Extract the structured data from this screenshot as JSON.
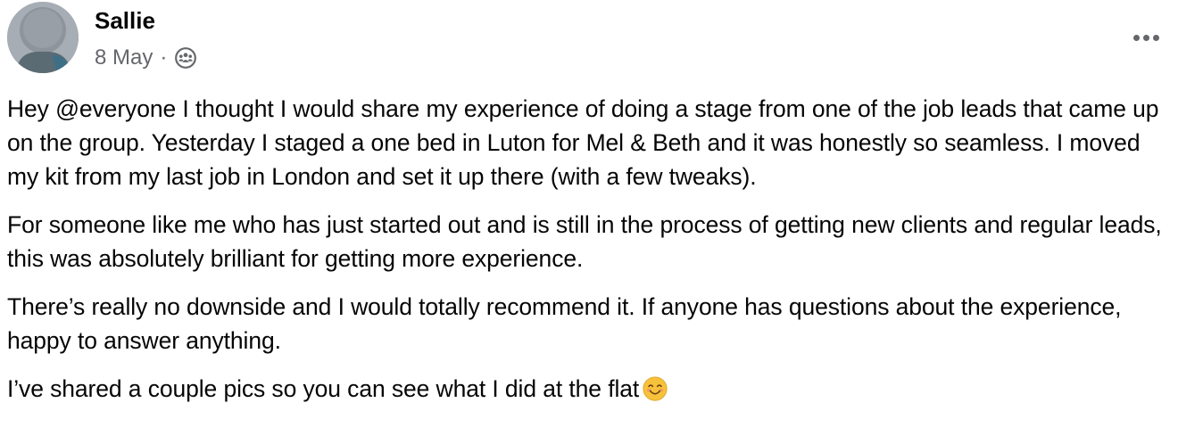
{
  "post": {
    "author": "Sallie",
    "date": "8 May",
    "separator": "·",
    "audience_icon": "group-audience-icon",
    "more_icon": "more-options-icon",
    "paragraphs": [
      "Hey @everyone I thought I would share my experience of doing a stage from one of the job leads that came up on the group. Yesterday I staged a one bed in Luton for Mel & Beth and it was honestly so seamless. I moved my kit from my last job in London and set it up there (with a few tweaks).",
      "For someone like me who has just started out and is still in the process of getting new clients and regular leads, this was absolutely brilliant for getting more experience.",
      "There’s really no downside and I would totally recommend it. If anyone has questions about the experience, happy to answer anything.",
      "I’ve shared a couple pics so you can see what I did at the flat"
    ],
    "trailing_emoji": "smiling-face-with-smiling-eyes-emoji"
  },
  "colors": {
    "text": "#050505",
    "secondary_text": "#65676b",
    "background": "#ffffff"
  }
}
